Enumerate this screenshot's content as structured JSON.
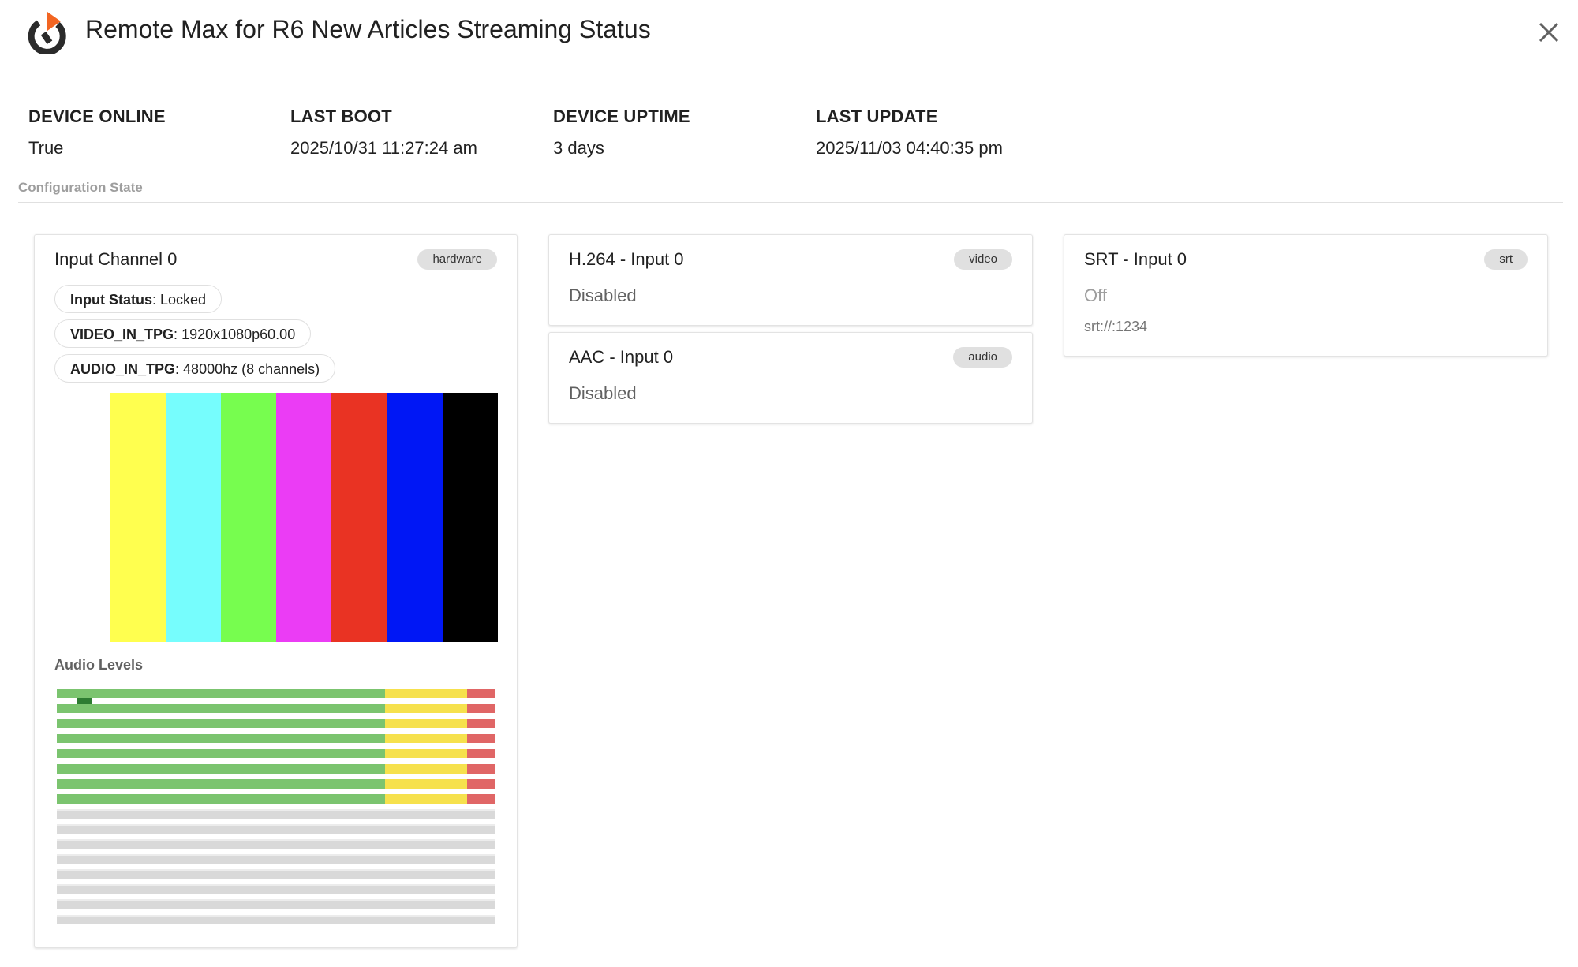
{
  "header": {
    "title": "Remote Max for R6 New Articles Streaming Status",
    "logo_icon": "power-play-icon",
    "close_icon": "close-icon",
    "accent_color": "#f26522"
  },
  "stats": [
    {
      "label": "DEVICE ONLINE",
      "value": "True"
    },
    {
      "label": "LAST BOOT",
      "value": "2025/10/31 11:27:24 am"
    },
    {
      "label": "DEVICE UPTIME",
      "value": "3 days"
    },
    {
      "label": "LAST UPDATE",
      "value": "2025/11/03 04:40:35 pm"
    }
  ],
  "section_label": "Configuration State",
  "input_card": {
    "title": "Input Channel 0",
    "badge": "hardware",
    "chips": [
      {
        "key": "Input Status",
        "value": "Locked"
      },
      {
        "key": "VIDEO_IN_TPG",
        "value": "1920x1080p60.00"
      },
      {
        "key": "AUDIO_IN_TPG",
        "value": "48000hz (8 channels)"
      }
    ],
    "colorbar_colors": [
      "#ffffff",
      "#ffff4f",
      "#76fdfd",
      "#77fd4f",
      "#eb3cf5",
      "#e93323",
      "#0017f5",
      "#000000"
    ],
    "indicator_color": "#2e7d32",
    "audio_levels_title": "Audio Levels",
    "audio_channels": [
      {
        "level": 1.0,
        "active": true
      },
      {
        "level": 1.0,
        "active": true
      },
      {
        "level": 1.0,
        "active": true
      },
      {
        "level": 1.0,
        "active": true
      },
      {
        "level": 1.0,
        "active": true
      },
      {
        "level": 1.0,
        "active": true
      },
      {
        "level": 1.0,
        "active": true
      },
      {
        "level": 1.0,
        "active": true
      },
      {
        "level": 0,
        "active": false
      },
      {
        "level": 0,
        "active": false
      },
      {
        "level": 0,
        "active": false
      },
      {
        "level": 0,
        "active": false
      },
      {
        "level": 0,
        "active": false
      },
      {
        "level": 0,
        "active": false
      },
      {
        "level": 0,
        "active": false
      },
      {
        "level": 0,
        "active": false
      }
    ],
    "meter_colors": {
      "green": "#7bc46f",
      "yellow": "#f6e14d",
      "red": "#e06666",
      "empty": "#d9d9d9"
    }
  },
  "h264_card": {
    "title": "H.264 - Input 0",
    "badge": "video",
    "status": "Disabled"
  },
  "aac_card": {
    "title": "AAC - Input 0",
    "badge": "audio",
    "status": "Disabled"
  },
  "srt_card": {
    "title": "SRT - Input 0",
    "badge": "srt",
    "status": "Off",
    "url": "srt://:1234"
  }
}
